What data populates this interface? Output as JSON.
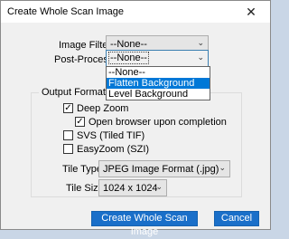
{
  "window": {
    "title": "Create Whole Scan Image",
    "close_glyph": "✕"
  },
  "image_filter": {
    "label": "Image Filter",
    "value": "--None--"
  },
  "post_process": {
    "label": "Post-Process",
    "value": "--None--",
    "options": [
      "--None--",
      "Flatten Background",
      "Level Background"
    ],
    "highlighted_option": "Flatten Background"
  },
  "output_formats": {
    "title": "Output Formats",
    "deep_zoom": {
      "label": "Deep Zoom",
      "checked": true
    },
    "open_browser": {
      "label": "Open browser upon completion",
      "checked": true
    },
    "svs": {
      "label": "SVS (Tiled TIF)",
      "checked": false
    },
    "easyzoom": {
      "label": "EasyZoom (SZI)",
      "checked": false
    },
    "tile_type": {
      "label": "Tile Type",
      "value": "JPEG Image Format (.jpg)"
    },
    "tile_size": {
      "label": "Tile Size",
      "value": "1024 x 1024"
    }
  },
  "buttons": {
    "create": "Create Whole Scan Image",
    "cancel": "Cancel"
  },
  "colors": {
    "accent": "#0078d7",
    "primary_button": "#1a6fc9"
  },
  "icons": {
    "close": "close-icon",
    "chevron": "chevron-down-icon",
    "check": "check-icon"
  }
}
